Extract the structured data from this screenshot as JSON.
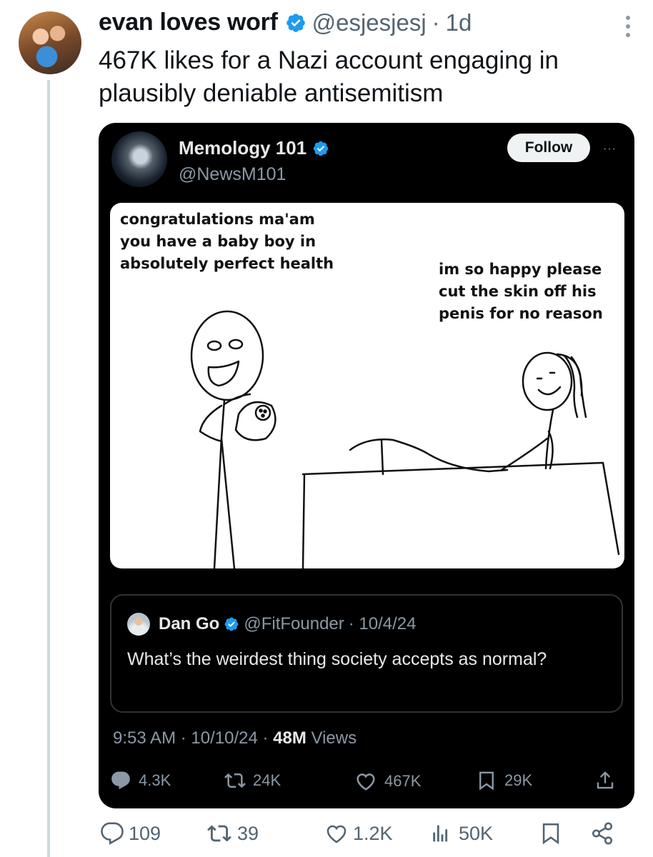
{
  "tweet": {
    "display_name": "evan loves worf",
    "handle": "@esjesjesj",
    "separator": "·",
    "time": "1d",
    "text": "467K likes for a Nazi account engaging in plausibly deniable antisemitism"
  },
  "quoted_post": {
    "display_name": "Memology 101",
    "handle": "@NewsM101",
    "follow_label": "Follow",
    "more_label": "···",
    "meme": {
      "left_caption": "congratulations ma'am\nyou have a baby boy in\nabsolutely perfect health",
      "right_caption": "im so happy please\ncut the skin off his\npenis for no reason"
    },
    "nested_quote": {
      "display_name": "Dan Go",
      "handle": "@FitFounder",
      "date": "· 10/4/24",
      "text": "What’s the weirdest thing society accepts as normal?"
    },
    "meta": {
      "time": "9:53 AM",
      "sep1": " · ",
      "date": "10/10/24",
      "sep2": " · ",
      "views_count": "48M",
      "views_label": " Views"
    },
    "actions": {
      "replies": "4.3K",
      "reposts": "24K",
      "likes": "467K",
      "bookmarks": "29K"
    }
  },
  "actions": {
    "replies": "109",
    "reposts": "39",
    "likes": "1.2K",
    "views": "50K"
  },
  "colors": {
    "verified_blue": "#1d9bf0",
    "secondary_text": "#536471",
    "dark_card": "#000000"
  }
}
